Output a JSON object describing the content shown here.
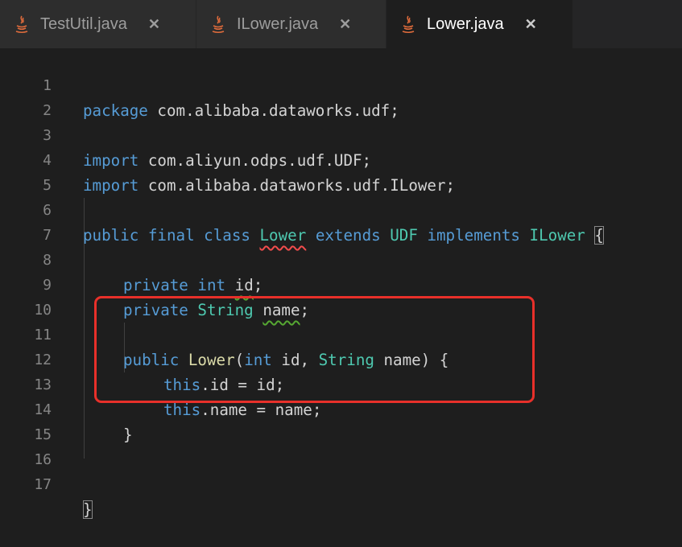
{
  "tabs": [
    {
      "label": "TestUtil.java",
      "icon": "java-file-icon",
      "active": false
    },
    {
      "label": "ILower.java",
      "icon": "java-file-icon",
      "active": false
    },
    {
      "label": "Lower.java",
      "icon": "java-file-icon",
      "active": true
    }
  ],
  "close_glyph": "✕",
  "line_numbers": [
    "1",
    "2",
    "3",
    "4",
    "5",
    "6",
    "7",
    "8",
    "9",
    "10",
    "11",
    "12",
    "13",
    "14",
    "15",
    "16",
    "17"
  ],
  "code": {
    "l1": {
      "kw": "package",
      "rest": " com.alibaba.dataworks.udf;"
    },
    "l3": {
      "kw": "import",
      "rest": " com.aliyun.odps.udf.UDF;"
    },
    "l4": {
      "kw": "import",
      "rest": " com.alibaba.dataworks.udf.ILower;"
    },
    "l6": {
      "kw1": "public",
      "kw2": " final",
      "kw3": " class",
      "cls": "Lower",
      "kw4": " extends",
      "sup": " UDF",
      "kw5": " implements",
      "iface": " ILower",
      "brace": "{"
    },
    "l8": {
      "kw1": "private",
      "kw2": " int",
      "name": "id",
      "end": ";"
    },
    "l9": {
      "kw1": "private",
      "typ": " String",
      "name": "name",
      "end": ";"
    },
    "l11": {
      "kw1": "public",
      "fn": "Lower",
      "p1": "(",
      "kw2": "int",
      "a1": " id, ",
      "typ": "String",
      "a2": " name) {"
    },
    "l12": {
      "kw": "this",
      "rest": ".id = id;"
    },
    "l13": {
      "kw": "this",
      "rest": ".name = name;"
    },
    "l14": {
      "rest": "}"
    },
    "l17": {
      "rest": "}"
    }
  },
  "colors": {
    "background": "#1e1e1e",
    "keyword": "#569cd6",
    "type": "#4ec9b0",
    "function": "#dcdcaa",
    "highlight_box": "#e8302a"
  }
}
